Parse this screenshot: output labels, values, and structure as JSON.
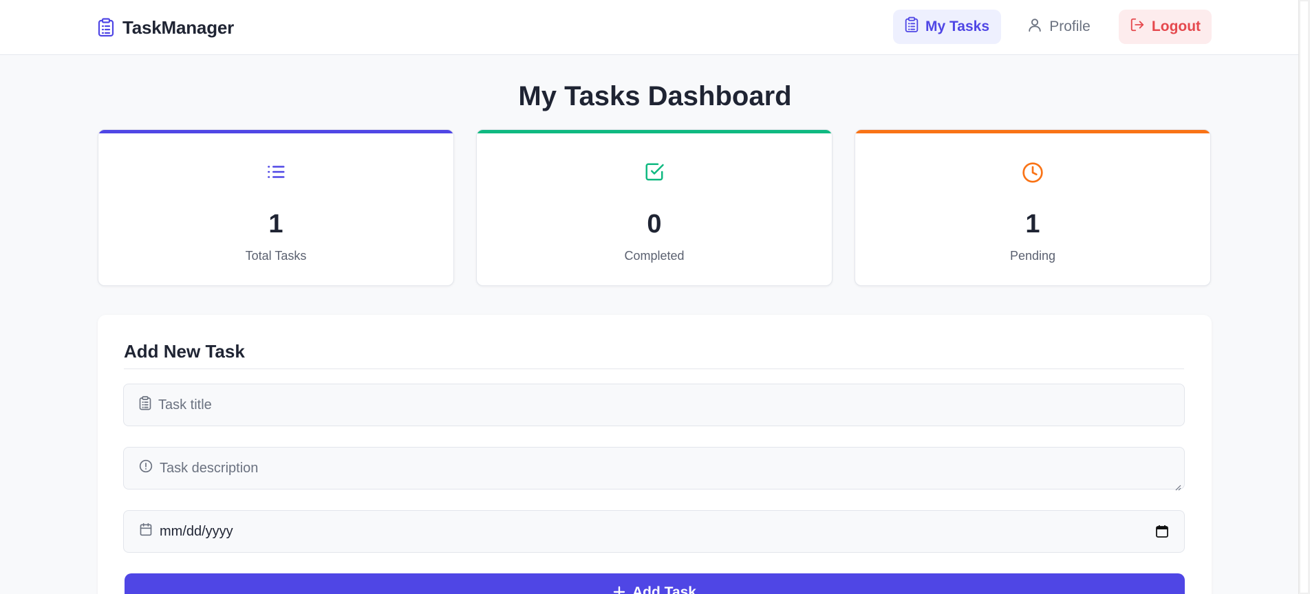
{
  "navbar": {
    "brand_name": "TaskManager",
    "brand_icon": "clipboard-list-icon",
    "items": [
      {
        "label": "My Tasks",
        "icon": "clipboard-icon",
        "active": true
      },
      {
        "label": "Profile",
        "icon": "user-icon",
        "active": false
      },
      {
        "label": "Logout",
        "icon": "logout-icon",
        "active": false
      }
    ]
  },
  "page": {
    "title": "My Tasks Dashboard"
  },
  "stats": [
    {
      "value": "1",
      "label": "Total Tasks",
      "icon": "list-icon",
      "color": "#4f46e5"
    },
    {
      "value": "0",
      "label": "Completed",
      "icon": "check-square-icon",
      "color": "#10b981"
    },
    {
      "value": "1",
      "label": "Pending",
      "icon": "clock-icon",
      "color": "#f97316"
    }
  ],
  "form": {
    "title": "Add New Task",
    "title_placeholder": "Task title",
    "description_placeholder": "Task description",
    "date_placeholder": "mm/dd/yyyy",
    "submit_label": "Add Task"
  },
  "colors": {
    "accent": "#4f46e5",
    "success": "#10b981",
    "warning": "#f97316",
    "danger": "#e5484d"
  }
}
